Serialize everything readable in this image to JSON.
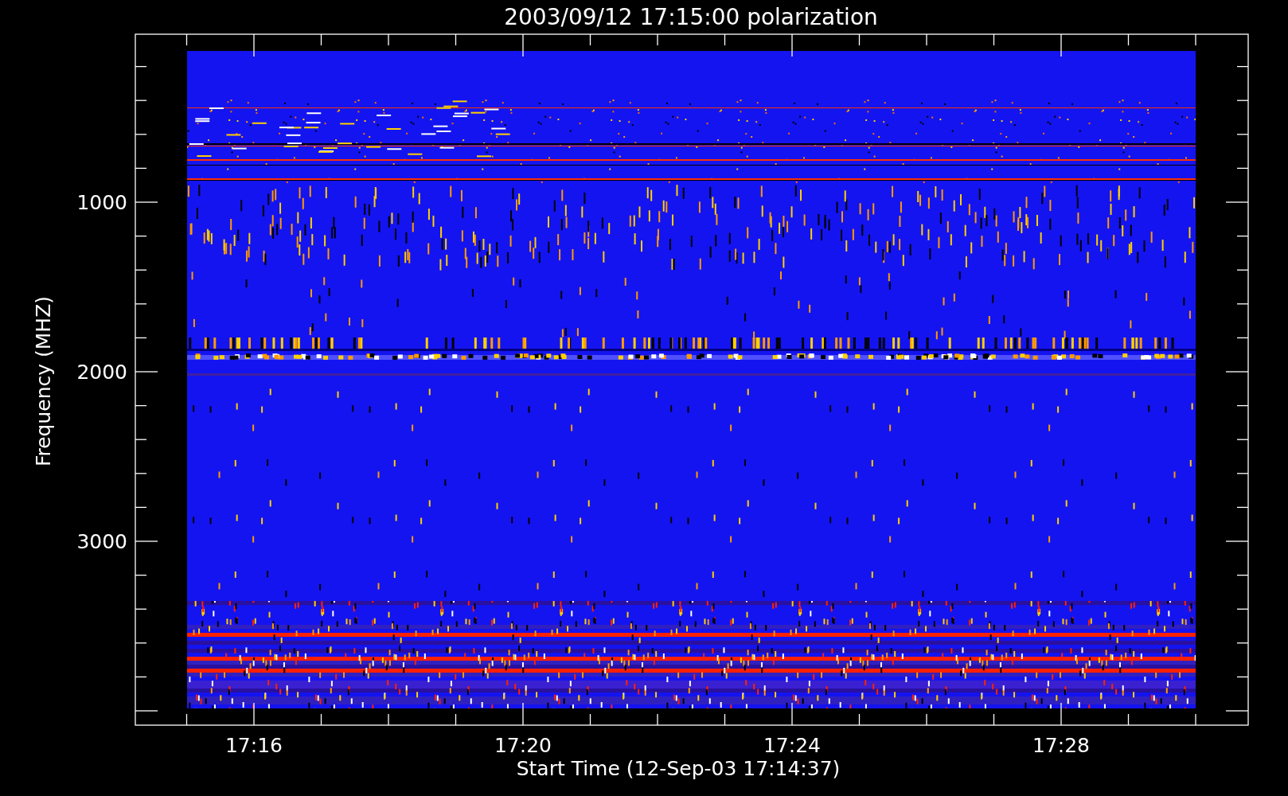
{
  "plot": {
    "title": "2003/09/12 17:15:00 polarization",
    "xlabel": "Start Time (12-Sep-03 17:14:37)",
    "ylabel": "Frequency (MHZ)",
    "yticks": [
      "1000",
      "2000",
      "3000"
    ],
    "xticks": [
      "17:16",
      "17:20",
      "17:24",
      "17:28"
    ]
  }
}
